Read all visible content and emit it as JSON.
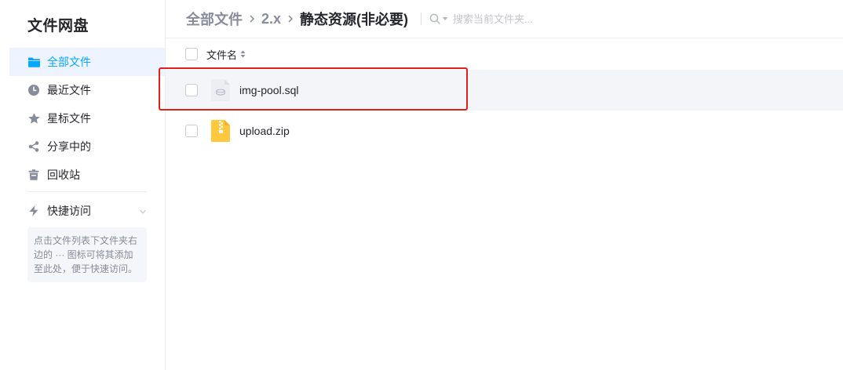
{
  "sidebar": {
    "title": "文件网盘",
    "items": [
      {
        "label": "全部文件",
        "icon": "folder-icon",
        "active": true
      },
      {
        "label": "最近文件",
        "icon": "clock-icon",
        "active": false
      },
      {
        "label": "星标文件",
        "icon": "star-icon",
        "active": false
      },
      {
        "label": "分享中的",
        "icon": "share-icon",
        "active": false
      },
      {
        "label": "回收站",
        "icon": "trash-icon",
        "active": false
      }
    ],
    "quick_access": {
      "label": "快捷访问",
      "icon": "lightning-icon"
    },
    "tip": "点击文件列表下文件夹右边的 ··· 图标可将其添加至此处，便于快速访问。"
  },
  "breadcrumb": {
    "items": [
      "全部文件",
      "2.x",
      "静态资源(非必要)"
    ]
  },
  "search": {
    "placeholder": "搜索当前文件夹..."
  },
  "list": {
    "header": {
      "name": "文件名"
    },
    "files": [
      {
        "name": "img-pool.sql",
        "icon": "sql-file-icon"
      },
      {
        "name": "upload.zip",
        "icon": "zip-file-icon"
      }
    ]
  },
  "colors": {
    "accent": "#06a7ff",
    "highlight": "#e0201b",
    "zip": "#ffc83d"
  }
}
